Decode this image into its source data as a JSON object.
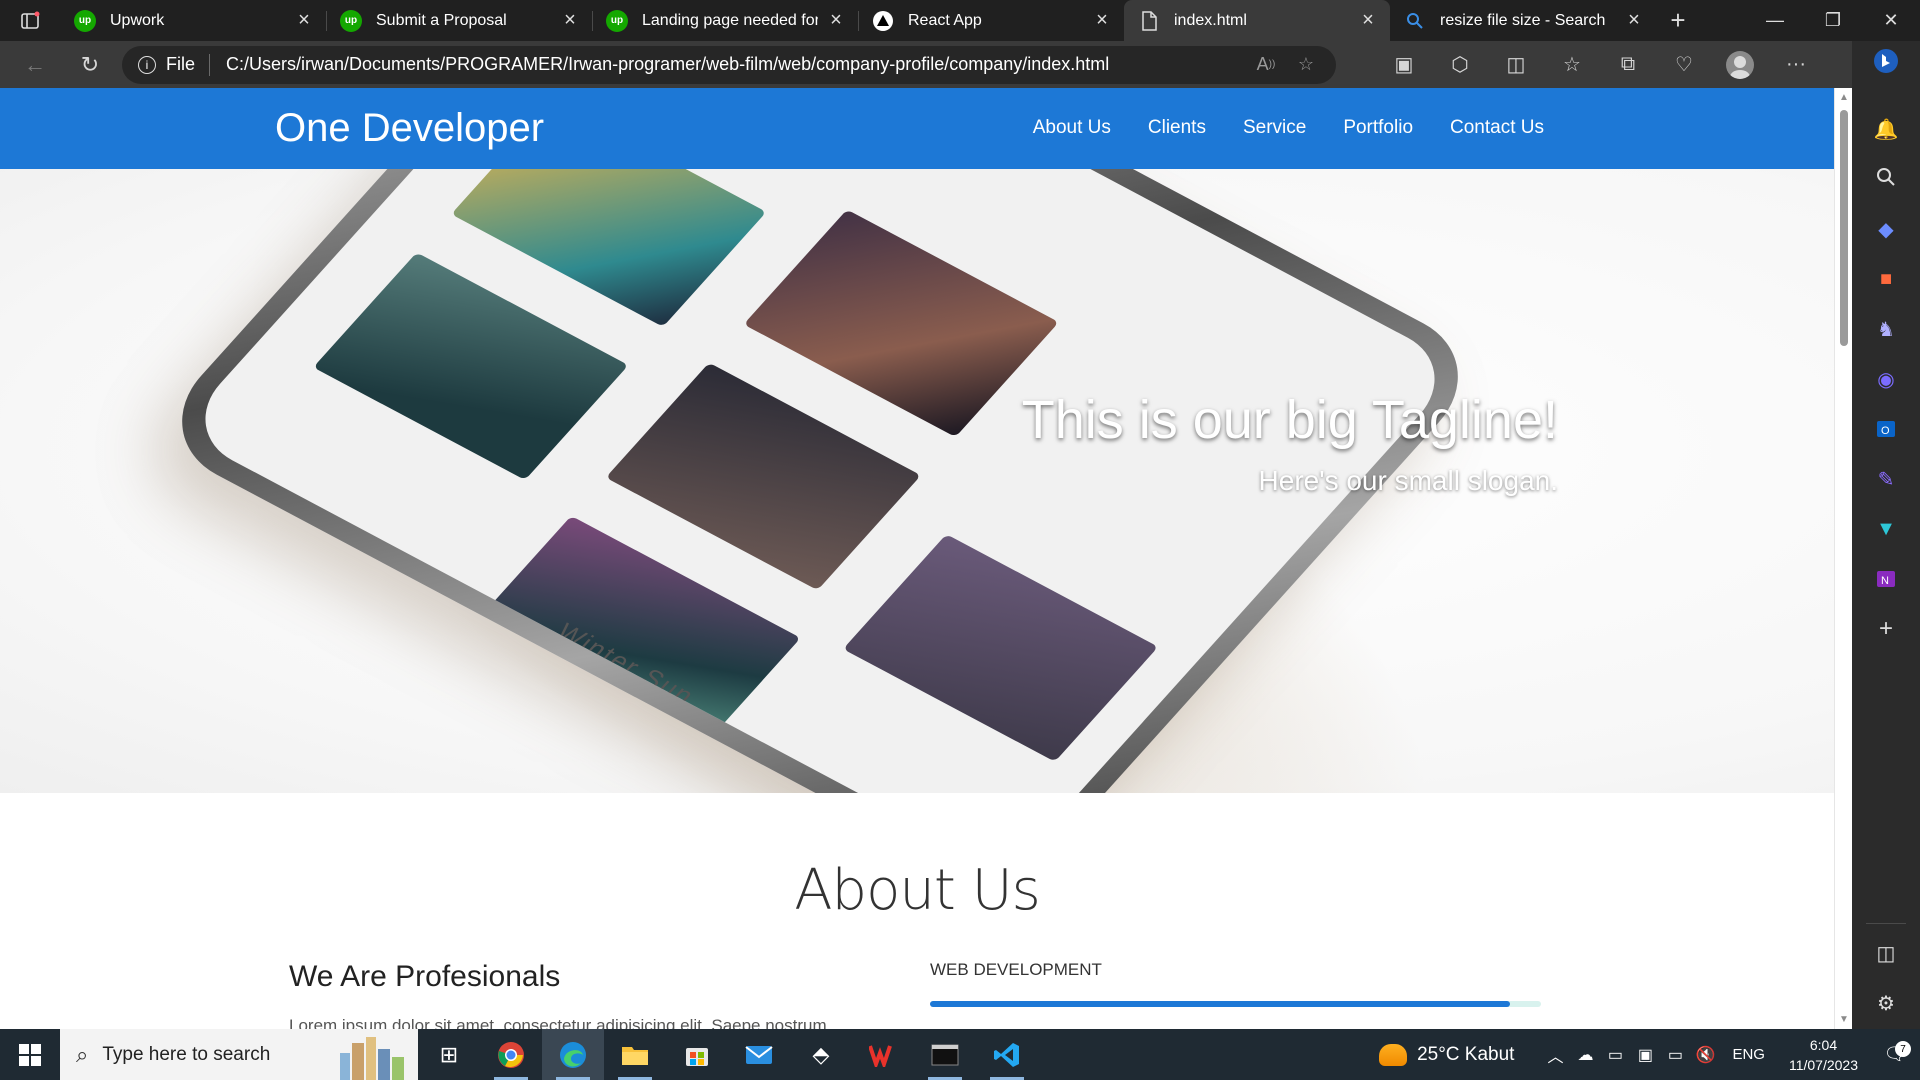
{
  "browser": {
    "tabs": [
      {
        "title": "Upwork",
        "favicon": "upwork-icon",
        "active": false
      },
      {
        "title": "Submit a Proposal",
        "favicon": "upwork-icon",
        "active": false
      },
      {
        "title": "Landing page needed for w",
        "favicon": "upwork-icon",
        "active": false
      },
      {
        "title": "React App",
        "favicon": "triangle-icon",
        "active": false
      },
      {
        "title": "index.html",
        "favicon": "document-icon",
        "active": true
      },
      {
        "title": "resize file size - Search",
        "favicon": "search-icon",
        "active": false
      }
    ],
    "address": {
      "site_label": "File",
      "url": "C:/Users/irwan/Documents/PROGRAMER/Irwan-programer/web-film/web/company-profile/company/index.html"
    }
  },
  "page": {
    "brand": "One Developer",
    "nav": [
      "About Us",
      "Clients",
      "Service",
      "Portfolio",
      "Contact Us"
    ],
    "hero": {
      "tagline": "This is our big Tagline!",
      "slogan": "Here's our small slogan.",
      "phone_caption": "Winter Sun"
    },
    "about": {
      "title": "About Us",
      "heading": "We Are Profesionals",
      "text": "Lorem ipsum dolor sit amet, consectetur adipisicing elit. Saepe nostrum",
      "skill_label": "WEB DEVELOPMENT",
      "skill_level": 0.95
    },
    "colors": {
      "primary": "#1d78d6",
      "skill_track": "#d8f2ee"
    }
  },
  "taskbar": {
    "search_placeholder": "Type here to search",
    "weather": "25°C  Kabut",
    "language": "ENG",
    "time": "6:04",
    "date": "11/07/2023",
    "notification_count": "7"
  }
}
